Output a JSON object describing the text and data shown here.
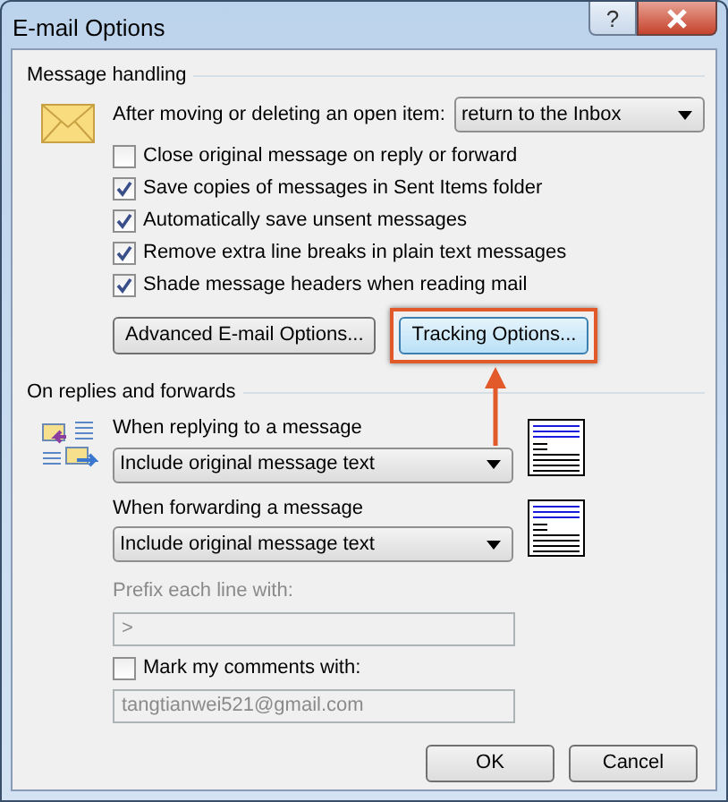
{
  "window": {
    "title": "E-mail Options",
    "help_label": "?"
  },
  "message_handling": {
    "title": "Message handling",
    "after_move": {
      "label": "After moving or deleting an open item:",
      "value": "return to the Inbox"
    },
    "checkboxes": [
      {
        "label": "Close original message on reply or forward",
        "checked": false
      },
      {
        "label": "Save copies of messages in Sent Items folder",
        "checked": true
      },
      {
        "label": "Automatically save unsent messages",
        "checked": true
      },
      {
        "label": "Remove extra line breaks in plain text messages",
        "checked": true
      },
      {
        "label": "Shade message headers when reading mail",
        "checked": true
      }
    ],
    "buttons": [
      {
        "label": "Advanced E-mail Options...",
        "highlighted": false
      },
      {
        "label": "Tracking Options...",
        "highlighted": true
      }
    ]
  },
  "replies_and_forwards": {
    "title": "On replies and forwards",
    "replying": {
      "label": "When replying to a message",
      "value": "Include original message text"
    },
    "forwarding": {
      "label": "When forwarding a message",
      "value": "Include original message text"
    },
    "prefix": {
      "label": "Prefix each line with:",
      "value": ">",
      "disabled": true
    },
    "mark_comments": {
      "label": "Mark my comments with:",
      "checked": false
    },
    "mark_text": {
      "value": "tangtianwei521@gmail.com",
      "disabled": true
    }
  },
  "footer_buttons": [
    "OK",
    "Cancel"
  ]
}
